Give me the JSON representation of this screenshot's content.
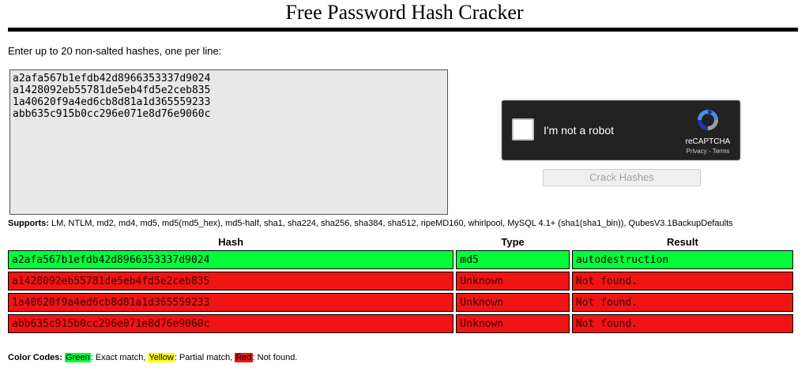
{
  "page": {
    "title": "Free Password Hash Cracker",
    "instructions": "Enter up to 20 non-salted hashes, one per line:"
  },
  "input": {
    "hashes": "a2afa567b1efdb42d8966353337d9024\na1428092eb55781de5eb4fd5e2ceb835\n1a40620f9a4ed6cb8d81a1d365559233\nabb635c915b0cc296e071e8d76e9060c"
  },
  "captcha": {
    "label": "I'm not a robot",
    "brand": "reCAPTCHA",
    "links": "Privacy - Terms"
  },
  "crack_button": {
    "label": "Crack Hashes"
  },
  "supports": {
    "label": "Supports:",
    "text": "LM, NTLM, md2, md4, md5, md5(md5_hex), md5-half, sha1, sha224, sha256, sha384, sha512, ripeMD160, whirlpool, MySQL 4.1+ (sha1(sha1_bin)), QubesV3.1BackupDefaults"
  },
  "results": {
    "headers": {
      "hash": "Hash",
      "type": "Type",
      "result": "Result"
    },
    "rows": [
      {
        "hash": "a2afa567b1efdb42d8966353337d9024",
        "type": "md5",
        "result": "autodestruction",
        "status": "green"
      },
      {
        "hash": "a1428092eb55781de5eb4fd5e2ceb835",
        "type": "Unknown",
        "result": "Not found.",
        "status": "red"
      },
      {
        "hash": "1a40620f9a4ed6cb8d81a1d365559233",
        "type": "Unknown",
        "result": "Not found.",
        "status": "red"
      },
      {
        "hash": "abb635c915b0cc296e071e8d76e9060c",
        "type": "Unknown",
        "result": "Not found.",
        "status": "red"
      }
    ]
  },
  "color_codes": {
    "label": "Color Codes:",
    "green": {
      "name": "Green",
      "desc": "Exact match,",
      "color": "#00ff3a"
    },
    "yellow": {
      "name": "Yellow",
      "desc": "Partial match,",
      "color": "#ffff00"
    },
    "red": {
      "name": "Red",
      "desc": "Not found.",
      "color": "#f01414"
    }
  },
  "colors": {
    "green": "#00ff3a",
    "red": "#f01414",
    "captcha_bg": "#222222"
  }
}
